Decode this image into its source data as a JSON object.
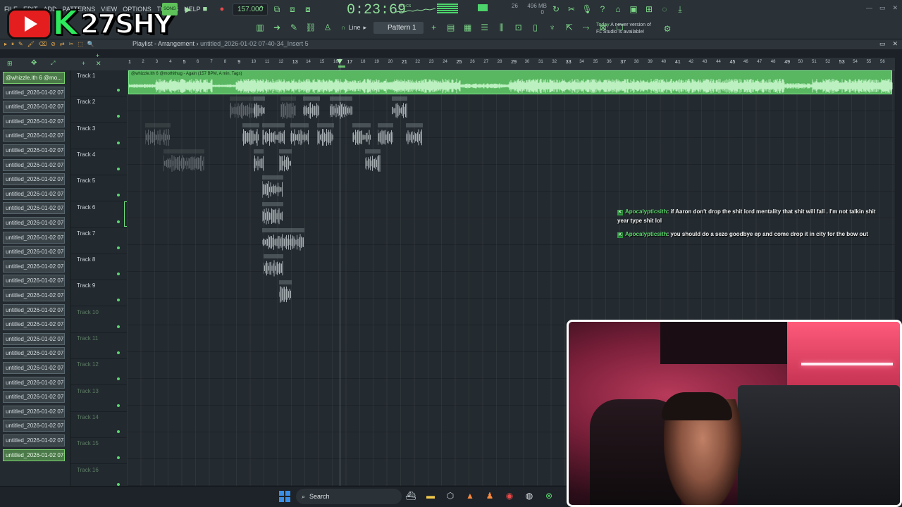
{
  "menu": [
    "FILE",
    "EDIT",
    "ADD",
    "PATTERNS",
    "VIEW",
    "OPTIONS",
    "TOOLS",
    "HELP"
  ],
  "logo": {
    "brand_text": "27SHY",
    "k_glyph": "K"
  },
  "transport": {
    "mode": "SONG",
    "tempo": "157.000",
    "time": "0:23:69",
    "time_unit": "M:S:CS"
  },
  "cpu": {
    "memory": "496 MB",
    "cpu_value": "26",
    "poly": "0"
  },
  "toolbar": {
    "snap_mode": "Line",
    "pattern": "Pattern 1"
  },
  "update_notice": {
    "day": "Today",
    "line1": "A newer version of",
    "line2": "FL Studio is available!"
  },
  "playlist": {
    "title": "Playlist - Arrangement",
    "crumb": "untitled_2026-01-02 07-40-34_Insert 5"
  },
  "picker": {
    "items": [
      "@whizzle.ith 6 @mo...",
      "untitled_2026-01-02 07-...",
      "untitled_2026-01-02 07-...",
      "untitled_2026-01-02 07-...",
      "untitled_2026-01-02 07-...",
      "untitled_2026-01-02 07-...",
      "untitled_2026-01-02 07-...",
      "untitled_2026-01-02 07-...",
      "untitled_2026-01-02 07-...",
      "untitled_2026-01-02 07-...",
      "untitled_2026-01-02 07-...",
      "untitled_2026-01-02 07-...",
      "untitled_2026-01-02 07-...",
      "untitled_2026-01-02 07-...",
      "untitled_2026-01-02 07-...",
      "untitled_2026-01-02 07-...",
      "untitled_2026-01-02 07-...",
      "untitled_2026-01-02 07-...",
      "untitled_2026-01-02 07-...",
      "untitled_2026-01-02 07-...",
      "untitled_2026-01-02 07-...",
      "untitled_2026-01-02 07-...",
      "untitled_2026-01-02 07-...",
      "untitled_2026-01-02 07-...",
      "untitled_2026-01-02 07-...",
      "untitled_2026-01-02 07-...",
      "untitled_2026-01-02 07-..."
    ]
  },
  "tracks": [
    "Track 1",
    "Track 2",
    "Track 3",
    "Track 4",
    "Track 5",
    "Track 6",
    "Track 7",
    "Track 8",
    "Track 9",
    "Track 10",
    "Track 11",
    "Track 12",
    "Track 13",
    "Track 14",
    "Track 15",
    "Track 16"
  ],
  "ruler_bars": [
    "1",
    "2",
    "3",
    "4",
    "5",
    "6",
    "7",
    "8",
    "9",
    "10",
    "11",
    "12",
    "13",
    "14",
    "15",
    "16",
    "17",
    "18",
    "19",
    "20",
    "21",
    "22",
    "23",
    "24",
    "25",
    "26",
    "27",
    "28",
    "29",
    "30",
    "31",
    "32",
    "33",
    "34",
    "35",
    "36",
    "37",
    "38",
    "39",
    "40",
    "41",
    "42",
    "43",
    "44",
    "45",
    "46",
    "47",
    "48",
    "49",
    "50",
    "51",
    "52",
    "53",
    "54",
    "55",
    "56"
  ],
  "track1_clip": {
    "title": "@whizzle.ith 6 @mothithug - Again (157 BPM, A min, Tags)"
  },
  "chat": [
    {
      "user": "Apocalypticsith",
      "text": ": if Aaron don't drop the shit lord mentality that shit will fall . I'm not talkin shit",
      "text2": "year type shit lol"
    },
    {
      "user": "Apocalypticsith",
      "text": ": you should do a sezo goodbye ep and come drop it in city for the bow out"
    }
  ],
  "taskbar": {
    "search_label": "Search"
  },
  "colors": {
    "accent_green": "#5bd66f",
    "clip_green": "#58b760",
    "record_red": "#e84a4a",
    "youtube_red": "#e41e1e"
  }
}
